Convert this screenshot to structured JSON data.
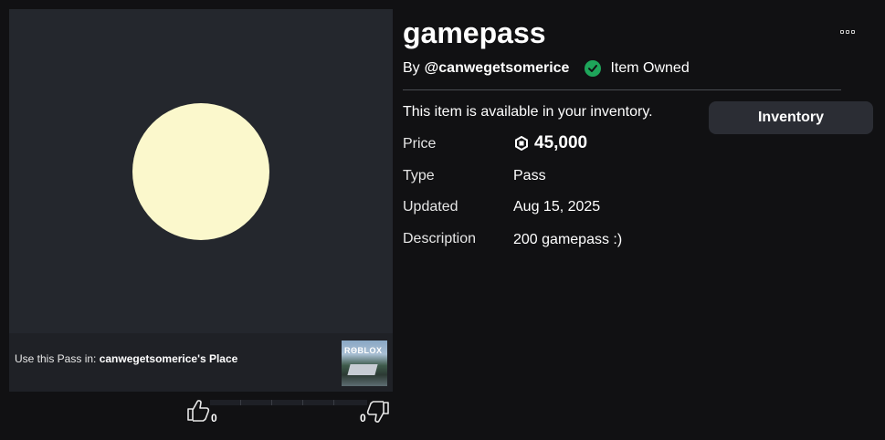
{
  "item": {
    "title": "gamepass",
    "by_label": "By",
    "creator": "@canwegetsomerice",
    "owned_label": "Item Owned",
    "availability": "This item is available in your inventory.",
    "inventory_button": "Inventory"
  },
  "details": {
    "price_label": "Price",
    "price_value": "45,000",
    "type_label": "Type",
    "type_value": "Pass",
    "updated_label": "Updated",
    "updated_value": "Aug 15, 2025",
    "description_label": "Description",
    "description_value": "200 gamepass :)"
  },
  "place": {
    "prefix": "Use this Pass in: ",
    "name": "canwegetsomerice's Place",
    "thumb_text": "RΘBLOX"
  },
  "votes": {
    "up": "0",
    "down": "0"
  },
  "colors": {
    "background": "#111113",
    "panel": "#24272d",
    "icon_fill": "#fbf8cc",
    "owned_green": "#1ea55a",
    "button_bg": "#2b2d34"
  },
  "icons": {
    "more": "more-options-icon",
    "owned": "check-circle-icon",
    "currency": "robux-icon",
    "upvote": "thumbs-up-icon",
    "downvote": "thumbs-down-icon"
  }
}
